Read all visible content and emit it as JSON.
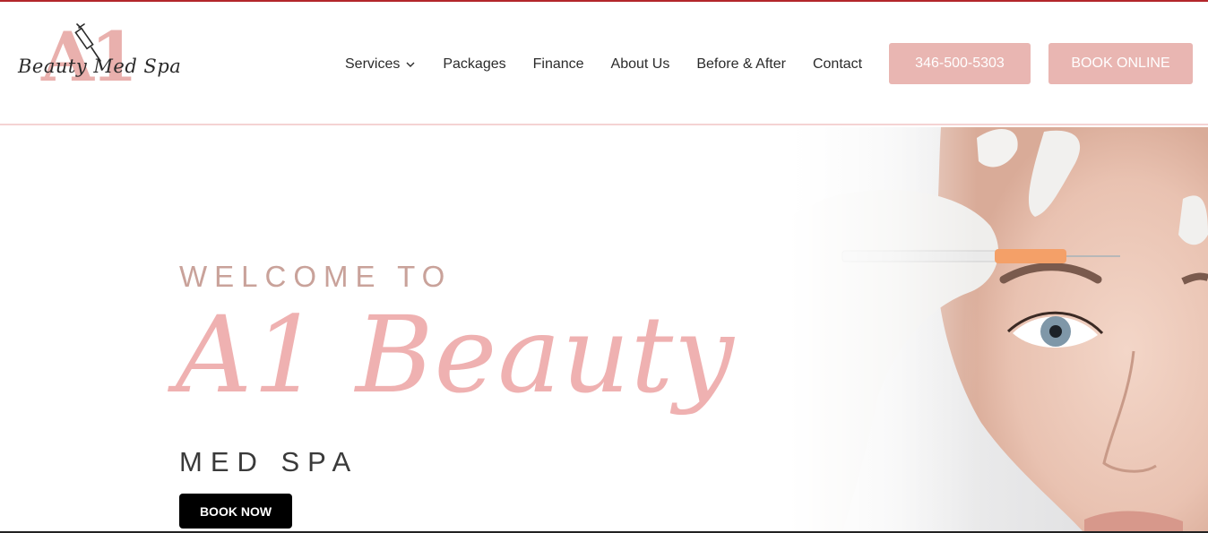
{
  "logo": {
    "mark": "A1",
    "script_text": "Beauty Med Spa",
    "icon": "syringe-icon"
  },
  "nav": {
    "items": [
      {
        "label": "Services",
        "has_dropdown": true,
        "icon": "chevron-down-icon"
      },
      {
        "label": "Packages"
      },
      {
        "label": "Finance"
      },
      {
        "label": "About Us"
      },
      {
        "label": "Before & After"
      },
      {
        "label": "Contact"
      }
    ]
  },
  "header_buttons": {
    "phone": "346-500-5303",
    "book_online": "BOOK ONLINE"
  },
  "hero": {
    "welcome": "WELCOME TO",
    "brand": "A1 Beauty",
    "subtitle": "MED SPA",
    "cta": "BOOK NOW"
  },
  "colors": {
    "top_stripe": "#b3262b",
    "accent_pink": "#e9b6b2",
    "brand_pink": "#efb1b1",
    "welcome_text": "#c9a29a",
    "cta_bg": "#000000"
  }
}
